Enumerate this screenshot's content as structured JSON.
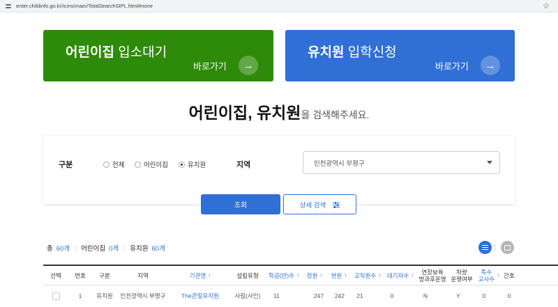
{
  "browser": {
    "url": "enter.childinfo.go.kr/icms/main/TotalSearchSIPL.html#none"
  },
  "banners": [
    {
      "title_bold": "어린이집",
      "title_light": "입소대기",
      "go_label": "바로가기",
      "color": "#2e8a09"
    },
    {
      "title_bold": "유치원",
      "title_light": "입학신청",
      "go_label": "바로가기",
      "color": "#2f6fd6"
    }
  ],
  "heading": {
    "strong": "어린이집, 유치원",
    "light": "을 검색해주세요."
  },
  "search": {
    "type_label": "구분",
    "options": [
      {
        "label": "전체",
        "selected": false
      },
      {
        "label": "어린이집",
        "selected": false
      },
      {
        "label": "유치원",
        "selected": true
      }
    ],
    "region_label": "지역",
    "region_value": "인천광역시 부평구",
    "search_button": "조회",
    "detail_button": "상세 검색"
  },
  "summary": {
    "total_label": "총",
    "total_count": "60개",
    "daycare_label": "어린이집",
    "daycare_count": "0개",
    "kinder_label": "유치원",
    "kinder_count": "60개"
  },
  "table": {
    "headers": {
      "select": "선택",
      "no": "번호",
      "type": "구분",
      "region": "지역",
      "name": "기관명",
      "est": "설립유형",
      "classes": "학급(반)수",
      "capacity": "정원",
      "current": "현원",
      "staff": "교직원수",
      "waiting": "대기자수",
      "extended_1": "연장보육",
      "extended_2": "방과후운영",
      "vehicle_1": "차량",
      "vehicle_2": "운행여부",
      "special_1": "특수",
      "special_2": "교사수",
      "last": "간호"
    },
    "rows": [
      {
        "no": "1",
        "type": "유치원",
        "region": "인천광역시 부평구",
        "name": "The큰빛유치원",
        "est": "사립(사인)",
        "classes": "11",
        "capacity": "247",
        "current": "242",
        "staff": "21",
        "waiting": "0",
        "extended": "N",
        "vehicle": "Y",
        "special": "0",
        "last": "0"
      }
    ]
  }
}
